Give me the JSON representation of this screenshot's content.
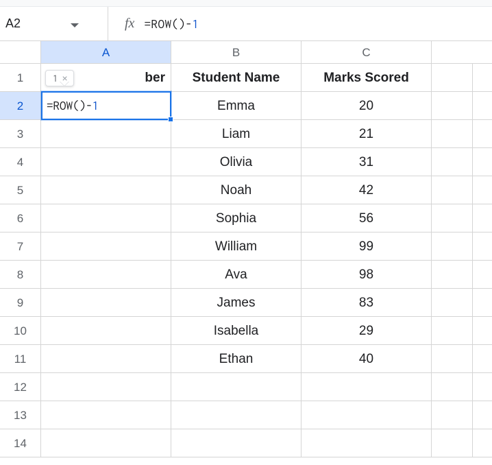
{
  "name_box": {
    "value": "A2"
  },
  "formula_bar": {
    "raw": "=ROW()-1",
    "eq": "=",
    "func": "ROW",
    "paren_open": "(",
    "paren_close": ")",
    "op": "-",
    "number": "1"
  },
  "columns": [
    "A",
    "B",
    "C"
  ],
  "rows": [
    "1",
    "2",
    "3",
    "4",
    "5",
    "6",
    "7",
    "8",
    "9",
    "10",
    "11",
    "12",
    "13",
    "14"
  ],
  "headers": {
    "a": "Number",
    "a_visible_fragment": "ber",
    "b": "Student Name",
    "c": "Marks Scored"
  },
  "data": [
    {
      "name": "Emma",
      "marks": "20"
    },
    {
      "name": "Liam",
      "marks": "21"
    },
    {
      "name": "Olivia",
      "marks": "31"
    },
    {
      "name": "Noah",
      "marks": "42"
    },
    {
      "name": "Sophia",
      "marks": "56"
    },
    {
      "name": "William",
      "marks": "99"
    },
    {
      "name": "Ava",
      "marks": "98"
    },
    {
      "name": "James",
      "marks": "83"
    },
    {
      "name": "Isabella",
      "marks": "29"
    },
    {
      "name": "Ethan",
      "marks": "40"
    }
  ],
  "active_cell": {
    "ref": "A2",
    "content": "=ROW()-1",
    "result_preview": "1"
  },
  "tooltip_close": "×"
}
